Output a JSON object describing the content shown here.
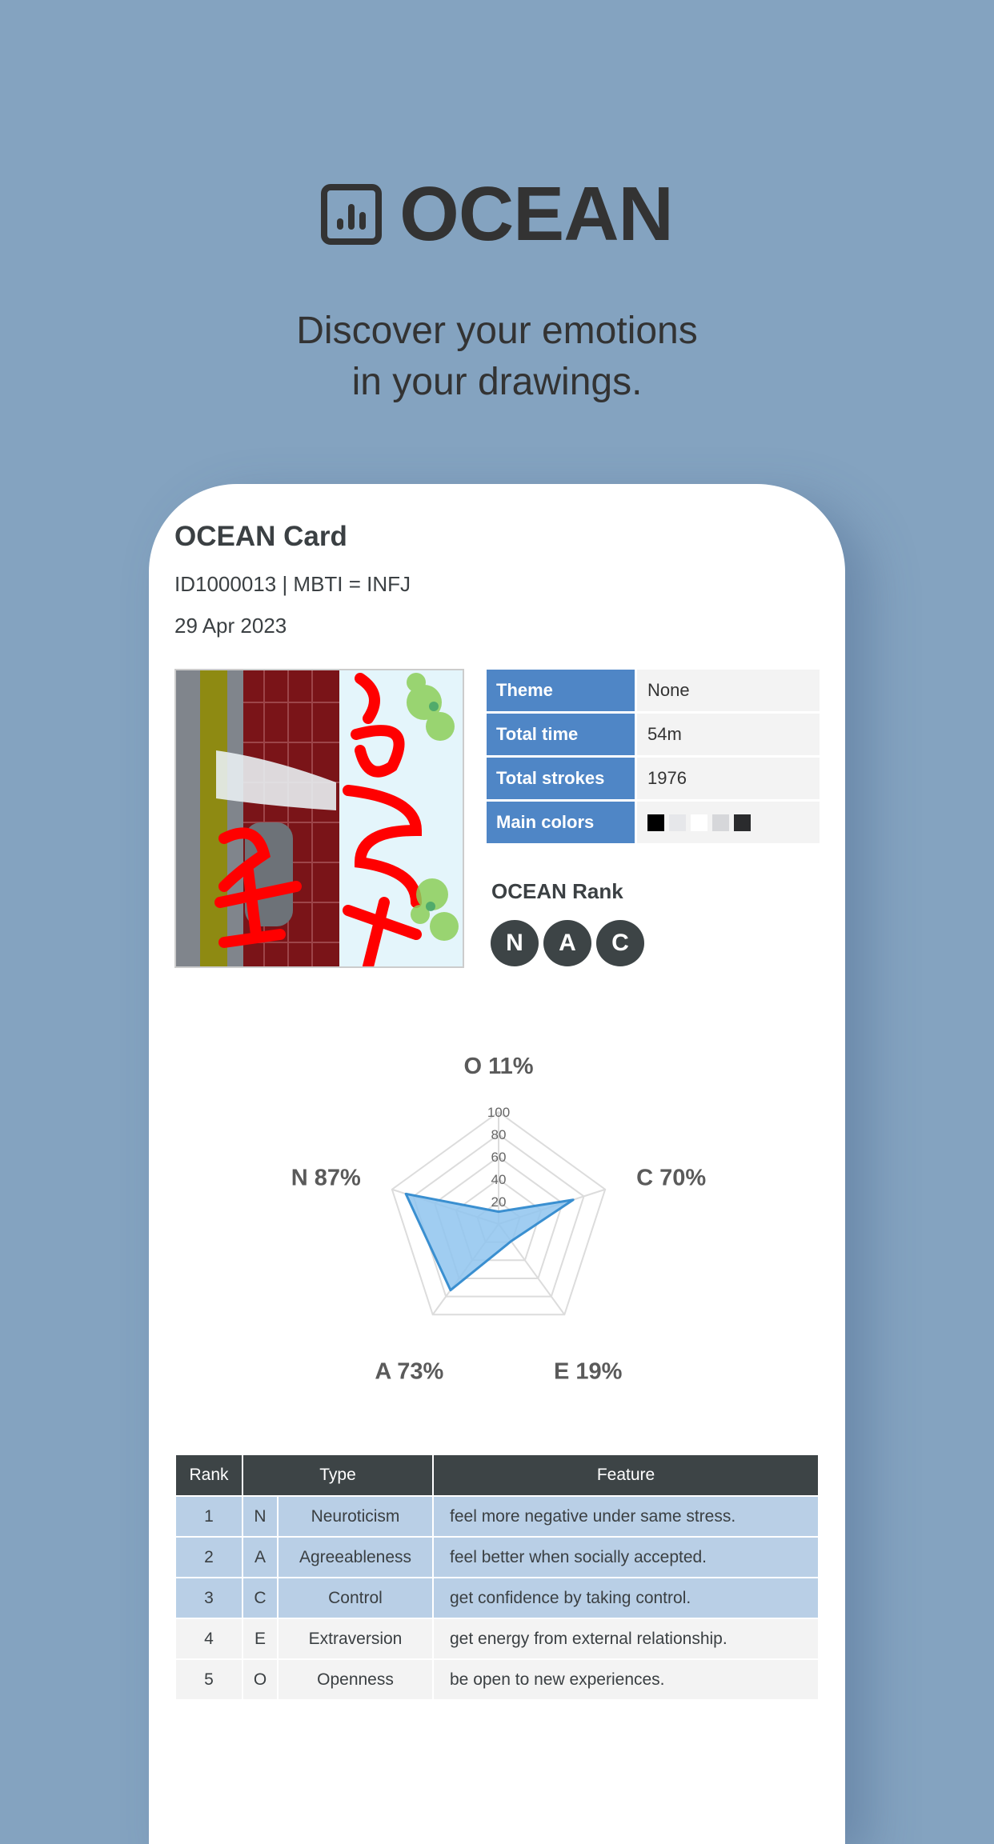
{
  "hero": {
    "icon": "bar-chart-icon",
    "title": "OCEAN",
    "tagline_line1": "Discover your emotions",
    "tagline_line2": "in your drawings."
  },
  "card": {
    "title": "OCEAN Card",
    "meta": "ID1000013 | MBTI = INFJ",
    "date": "29 Apr 2023",
    "drawing_alt": "user drawing thumbnail",
    "info": [
      {
        "label": "Theme",
        "value": "None"
      },
      {
        "label": "Total time",
        "value": "54m"
      },
      {
        "label": "Total strokes",
        "value": "1976"
      },
      {
        "label": "Main colors",
        "value": ""
      }
    ],
    "main_colors": [
      "#000000",
      "#e6e7ea",
      "#ffffff",
      "#d6d7da",
      "#2a2b2d"
    ],
    "rank_title": "OCEAN Rank",
    "rank_badges": [
      "N",
      "A",
      "C"
    ],
    "colors": {
      "header_blue": "#4f86c6",
      "badge_dark": "#3d4446",
      "highlight_row": "#b9cfe6",
      "radar_fill": "#8fc4ee",
      "radar_stroke": "#3a8fd0"
    }
  },
  "chart_data": {
    "type": "radar",
    "axes": [
      "O",
      "C",
      "E",
      "A",
      "N"
    ],
    "values": [
      11,
      70,
      19,
      73,
      87
    ],
    "labels": [
      "O 11%",
      "C 70%",
      "E 19%",
      "A 73%",
      "N 87%"
    ],
    "ticks": [
      "20",
      "40",
      "60",
      "80",
      "100"
    ],
    "range": [
      0,
      100
    ],
    "grid": true
  },
  "table": {
    "headers": {
      "rank": "Rank",
      "type": "Type",
      "feature": "Feature"
    },
    "rows": [
      {
        "rank": "1",
        "code": "N",
        "type": "Neuroticism",
        "feature": "feel more negative under same stress."
      },
      {
        "rank": "2",
        "code": "A",
        "type": "Agreeableness",
        "feature": "feel better when socially accepted."
      },
      {
        "rank": "3",
        "code": "C",
        "type": "Control",
        "feature": "get confidence by taking control."
      },
      {
        "rank": "4",
        "code": "E",
        "type": "Extraversion",
        "feature": "get energy from external relationship."
      },
      {
        "rank": "5",
        "code": "O",
        "type": "Openness",
        "feature": "be open to new experiences."
      }
    ]
  }
}
